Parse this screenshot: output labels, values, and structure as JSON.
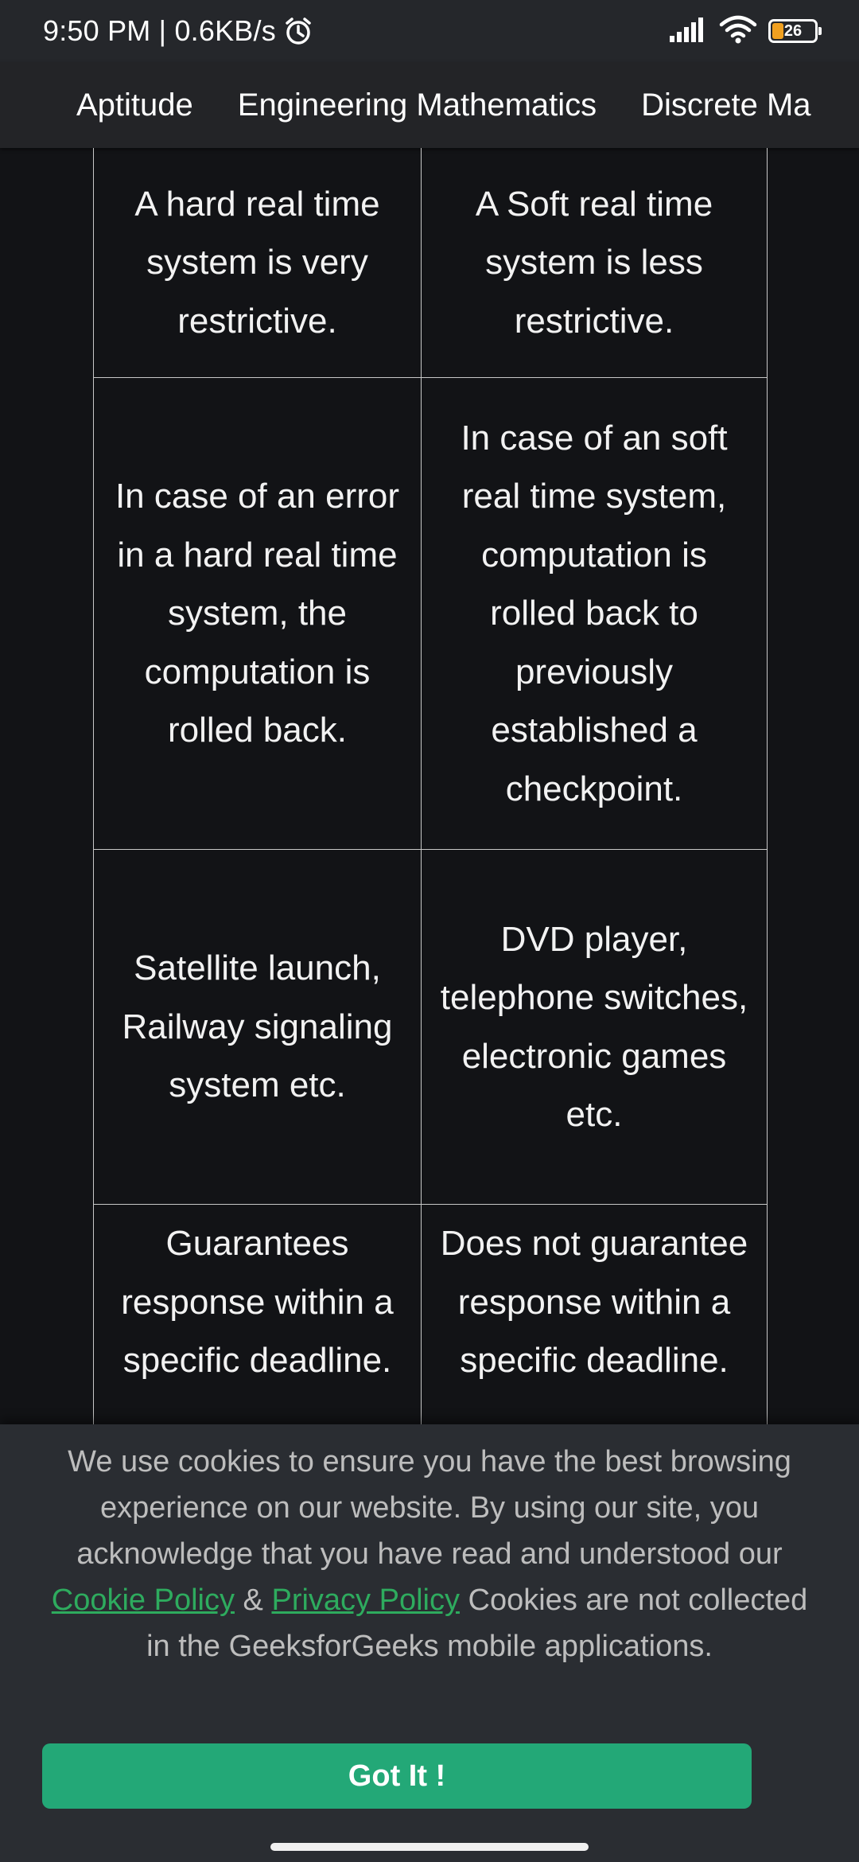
{
  "status_bar": {
    "time": "9:50 PM",
    "separator": " | ",
    "network_speed": "0.6KB/s",
    "battery_level": "26",
    "battery_fraction": 0.26,
    "icons": [
      "alarm-icon",
      "signal-icon",
      "wifi-icon",
      "battery-icon"
    ]
  },
  "nav": {
    "items": [
      {
        "label": "Aptitude"
      },
      {
        "label": "Engineering Mathematics"
      },
      {
        "label": "Discrete Ma"
      }
    ]
  },
  "table": {
    "rows": [
      {
        "hard": "A hard real time system is very restrictive.",
        "soft": "A Soft real time system is less restrictive."
      },
      {
        "hard": "In case of an error in a hard real time system, the computation is rolled back.",
        "soft": "In case of an soft real time system, computation is rolled back to previously established a checkpoint."
      },
      {
        "hard": "Satellite launch, Railway signaling system etc.",
        "soft": "DVD player, telephone switches, electronic games etc."
      },
      {
        "hard": "Guarantees response within a specific deadline.",
        "soft": "Does not guarantee response within a specific deadline."
      }
    ]
  },
  "cookie_banner": {
    "text_before": "We use cookies to ensure you have the best browsing experience on our website. By using our site, you acknowledge that you have read and understood our ",
    "cookie_policy_link": "Cookie Policy",
    "ampersand": " & ",
    "privacy_policy_link": "Privacy Policy",
    "text_after": " Cookies are not collected in the GeeksforGeeks mobile applications.",
    "button_label": "Got It !"
  },
  "colors": {
    "background": "#121316",
    "status_bar": "#25272b",
    "nav_bar": "#232427",
    "cookie_banner": "#2a2d32",
    "link_green": "#2eab5e",
    "button_green": "#23a877",
    "battery_fill": "#f0a020"
  }
}
